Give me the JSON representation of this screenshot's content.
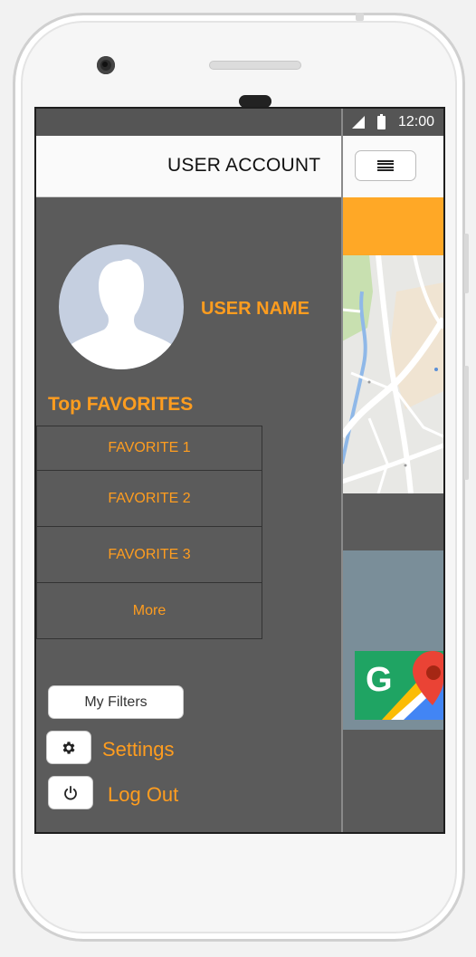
{
  "status_bar": {
    "time": "12:00",
    "icons": [
      "signal-icon",
      "battery-icon"
    ]
  },
  "drawer": {
    "header_title": "USER ACCOUNT",
    "user_name": "USER NAME",
    "favorites_title": "Top FAVORITES",
    "favorites": [
      {
        "label": "FAVORITE 1"
      },
      {
        "label": "FAVORITE 2"
      },
      {
        "label": "FAVORITE 3"
      },
      {
        "label": "More"
      }
    ],
    "filters_label": "My Filters",
    "settings_label": "Settings",
    "logout_label": "Log Out"
  },
  "background_app": {
    "menu_icon": "hamburger-icon",
    "accent_color": "#ffa826"
  },
  "colors": {
    "accent": "#ff9d1f",
    "drawer_bg": "#5b5b5b",
    "header_bg": "#fafafa",
    "slate": "#7a8e99"
  }
}
